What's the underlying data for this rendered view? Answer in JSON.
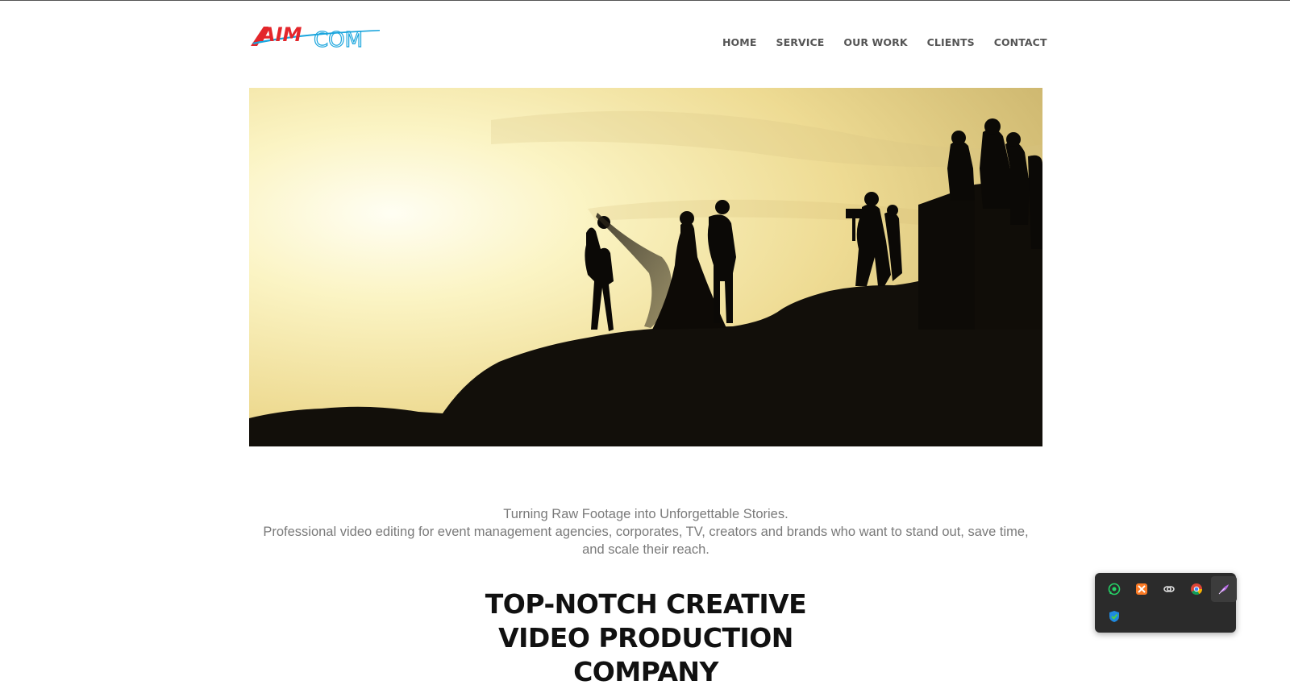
{
  "brand": {
    "logo_text_left": "AIM",
    "logo_text_right": "COM",
    "logo_red": "#e3262b",
    "logo_blue": "#1aa5dd"
  },
  "nav": {
    "items": [
      {
        "label": "HOME"
      },
      {
        "label": "SERVICE"
      },
      {
        "label": "OUR WORK"
      },
      {
        "label": "CLIENTS"
      },
      {
        "label": "CONTACT"
      }
    ]
  },
  "intro": {
    "line1": "Turning Raw Footage into Unforgettable Stories.",
    "line2": "Professional video editing for event management agencies, corporates, TV, creators and brands who want to stand out, save time, and scale their reach."
  },
  "headline": "TOP-NOTCH CREATIVE VIDEO PRODUCTION COMPANY",
  "system_tray": {
    "icons": [
      "whatsapp-icon",
      "xampp-icon",
      "copilot-icon",
      "chrome-icon",
      "feather-icon",
      "windows-security-icon"
    ]
  }
}
